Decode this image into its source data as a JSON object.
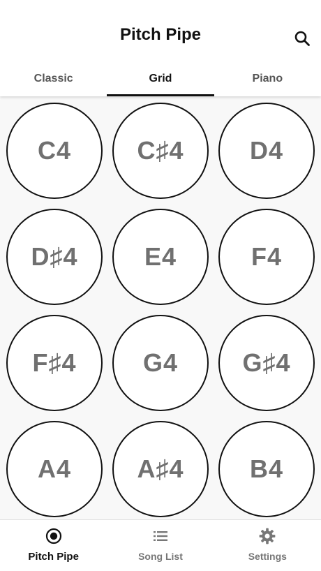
{
  "header": {
    "title": "Pitch Pipe",
    "search_icon": "search-icon"
  },
  "tabs": [
    {
      "label": "Classic",
      "active": false
    },
    {
      "label": "Grid",
      "active": true
    },
    {
      "label": "Piano",
      "active": false
    }
  ],
  "notes": [
    {
      "label": "C4"
    },
    {
      "label": "C♯4"
    },
    {
      "label": "D4"
    },
    {
      "label": "D♯4"
    },
    {
      "label": "E4"
    },
    {
      "label": "F4"
    },
    {
      "label": "F♯4"
    },
    {
      "label": "G4"
    },
    {
      "label": "G♯4"
    },
    {
      "label": "A4"
    },
    {
      "label": "A♯4"
    },
    {
      "label": "B4"
    }
  ],
  "bottom_nav": [
    {
      "label": "Pitch Pipe",
      "icon": "radio-button-icon",
      "active": true
    },
    {
      "label": "Song List",
      "icon": "list-icon",
      "active": false
    },
    {
      "label": "Settings",
      "icon": "gear-icon",
      "active": false
    }
  ],
  "colors": {
    "accent": "#111111",
    "note_text": "#707070",
    "inactive": "#777777"
  }
}
